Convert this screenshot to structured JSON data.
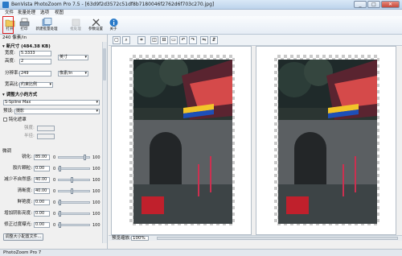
{
  "window": {
    "title": "BenVista PhotoZoom Pro 7.5 - [63d9f2d3572c51df8b7180046f2762d6f703c270.jpg]",
    "controls": [
      "_",
      "□",
      "✕"
    ]
  },
  "menu": [
    "文件",
    "批量处理",
    "选项",
    "视图"
  ],
  "toolbar": [
    {
      "label": "打开",
      "icon": "folder-open-icon"
    },
    {
      "label": "打印",
      "icon": "printer-icon"
    },
    {
      "label": "新建批量处理",
      "icon": "batch-new-icon"
    },
    {
      "label": "批处理",
      "icon": "batch-icon"
    },
    {
      "label": "参数设置",
      "icon": "settings-icon"
    },
    {
      "label": "关于",
      "icon": "info-icon"
    }
  ],
  "left_panel": {
    "source_size": "240 像素/in",
    "new_size_header": "新尺寸 (484.38 KB)",
    "width_label": "宽度:",
    "width_value": "5.3333",
    "height_label": "高度:",
    "height_value": "2",
    "unit_value": "英寸",
    "resolution_label": "分辨率:",
    "resolution_value": "249",
    "res_unit_value": "像素/in",
    "ratio_label": "宽高比:",
    "ratio_value": "约束比例",
    "resize_method_header": "调整大小的方式",
    "method_value": "S-Spline Max",
    "preset_label": "预设:",
    "preset_value": "摄影",
    "unsharp_label": "钝化遮罩",
    "unsharp_strength": "强度:",
    "unsharp_radius": "半径:",
    "fine_tune_header": "微调",
    "sliders": [
      {
        "label": "锐化:",
        "value": "85.00",
        "max": "100",
        "level": 85
      },
      {
        "label": "胶片颗粒:",
        "value": "0.00",
        "max": "100",
        "level": 0
      },
      {
        "label": "减少不自然感:",
        "value": "40.00",
        "max": "100",
        "level": 40
      },
      {
        "label": "清晰度:",
        "value": "40.00",
        "max": "100",
        "level": 40
      },
      {
        "label": "鲜艳度:",
        "value": "0.00",
        "max": "100",
        "level": 0
      },
      {
        "label": "增加阴影亮度:",
        "value": "0.00",
        "max": "100",
        "level": 0
      },
      {
        "label": "修正过度曝光:",
        "value": "0.00",
        "max": "100",
        "level": 0
      }
    ],
    "slider_min": "0",
    "resize_button": "调整大小配置文件..."
  },
  "view": {
    "zoom_label": "预览缩放:",
    "zoom_value": "100%"
  },
  "status": {
    "text": "PhotoZoom Pro 7"
  },
  "colors": {
    "highlight": "#e02020",
    "accent": "#2a7ac8"
  }
}
